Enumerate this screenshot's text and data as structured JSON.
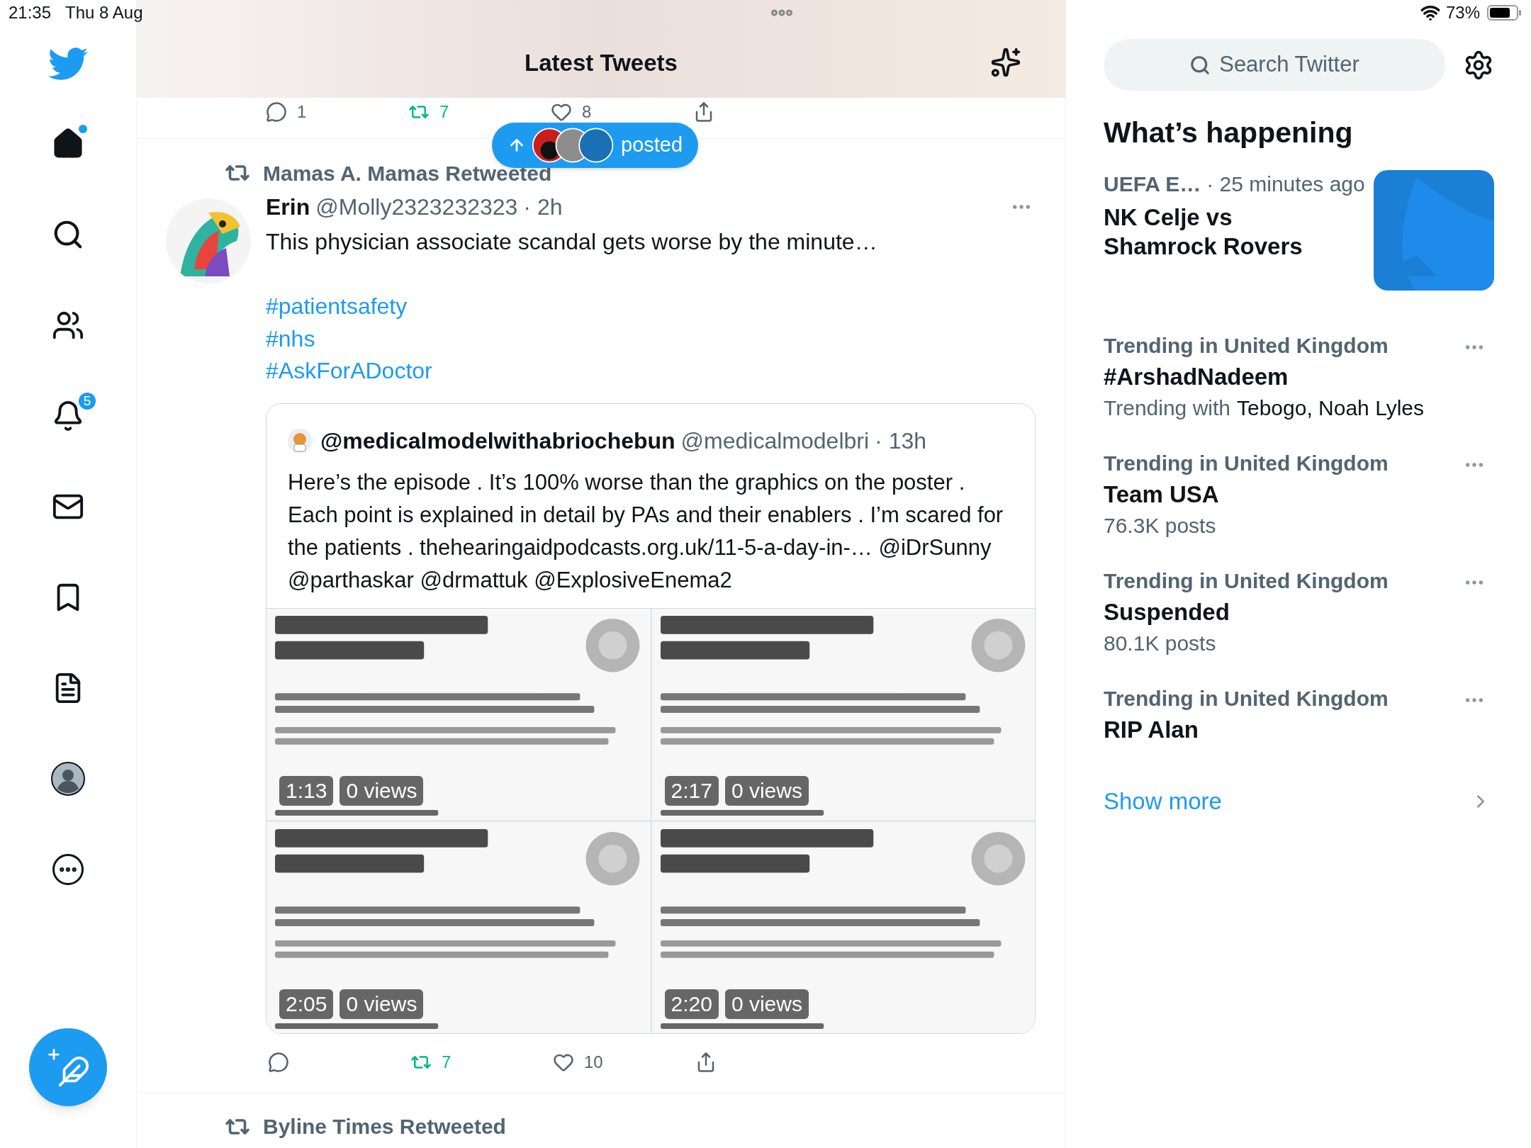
{
  "status_bar": {
    "time": "21:35",
    "date": "Thu 8 Aug",
    "battery": "73%"
  },
  "nav": [
    {
      "kind": "logo"
    },
    {
      "kind": "home",
      "dot": true
    },
    {
      "kind": "search"
    },
    {
      "kind": "communities"
    },
    {
      "kind": "notifications",
      "badge": "5"
    },
    {
      "kind": "messages"
    },
    {
      "kind": "bookmarks"
    },
    {
      "kind": "lists"
    },
    {
      "kind": "profile"
    },
    {
      "kind": "more"
    }
  ],
  "header": {
    "title": "Latest Tweets"
  },
  "new_posts_pill": {
    "label": "posted"
  },
  "previous_tweet_actions": [
    {
      "kind": "reply",
      "count": "1"
    },
    {
      "kind": "retweet",
      "count": "7",
      "active": true
    },
    {
      "kind": "like",
      "count": "8"
    },
    {
      "kind": "share"
    }
  ],
  "tweets": [
    {
      "retweeted_by": "Mamas A. Mamas Retweeted",
      "name": "Erin",
      "handle": "@Molly2323232323",
      "time": "· 2h",
      "text": "This physician associate scandal gets worse by the minute…",
      "hashtags": [
        "#patientsafety",
        "#nhs",
        "#AskForADoctor"
      ],
      "quote": {
        "name": "@medicalmodelwithabriochebun",
        "handle": "@medicalmodelbri",
        "time": "· 13h",
        "text": "Here’s the episode . It’s 100% worse than the graphics on the poster . Each point is explained in detail by PAs and their enablers . I’m scared for the patients . thehearingaidpodcasts.org.uk/11-5-a-day-in-… @iDrSunny @parthaskar @drmattuk @ExplosiveEnema2",
        "media": [
          {
            "kind": "picture",
            "duration": "1:13",
            "views": "0 views"
          },
          {
            "kind": "picture",
            "duration": "2:17",
            "views": "0 views"
          },
          {
            "kind": "picture",
            "duration": "2:05",
            "views": "0 views"
          },
          {
            "kind": "picture",
            "duration": "2:20",
            "views": "0 views"
          }
        ]
      },
      "actions": [
        {
          "kind": "reply"
        },
        {
          "kind": "retweet",
          "count": "7",
          "active": true
        },
        {
          "kind": "like",
          "count": "10"
        },
        {
          "kind": "share"
        }
      ]
    },
    {
      "retweeted_by": "Byline Times Retweeted"
    }
  ],
  "sidebar": {
    "search": {
      "placeholder": "Search Twitter"
    },
    "title": "What’s happening",
    "trends": [
      {
        "kind": "event",
        "meta": "UEFA E…",
        "time": "· 25 minutes ago",
        "title": "NK Celje vs Shamrock Rovers"
      },
      {
        "kind": "trend",
        "meta": "Trending in United Kingdom",
        "title": "#ArshadNadeem",
        "subtitle": "Trending with",
        "subtitle_names": "Tebogo, Noah Lyles"
      },
      {
        "kind": "trend",
        "meta": "Trending in United Kingdom",
        "title": "Team USA",
        "subtitle": "76.3K posts"
      },
      {
        "kind": "trend",
        "meta": "Trending in United Kingdom",
        "title": "Suspended",
        "subtitle": "80.1K posts"
      },
      {
        "kind": "trend",
        "meta": "Trending in United Kingdom",
        "title": "RIP Alan"
      }
    ],
    "show_more": "Show more"
  }
}
